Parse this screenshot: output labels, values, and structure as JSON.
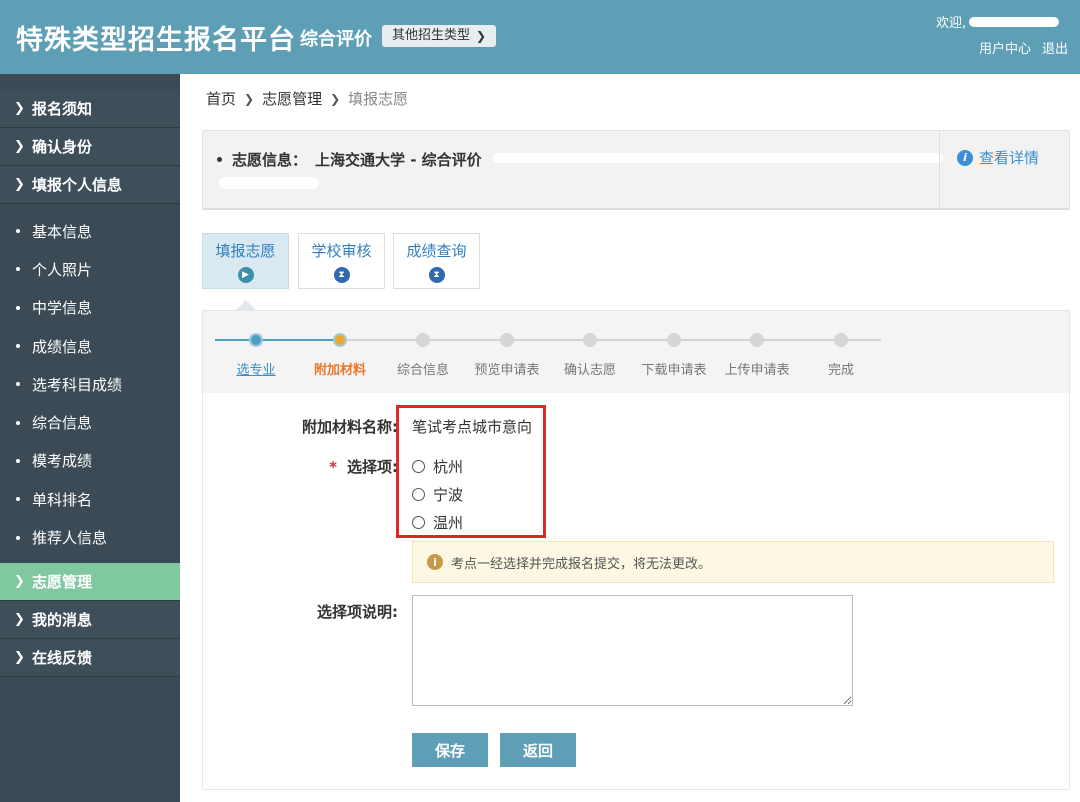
{
  "header": {
    "brand": "特殊类型招生报名平台",
    "subtitle": "综合评价",
    "other_type_label": "其他招生类型",
    "welcome": "欢迎,",
    "user_center": "用户中心",
    "logout": "退出"
  },
  "sidebar": {
    "items": [
      {
        "label": "报名须知"
      },
      {
        "label": "确认身份"
      },
      {
        "label": "填报个人信息"
      }
    ],
    "sub_items": [
      {
        "label": "基本信息"
      },
      {
        "label": "个人照片"
      },
      {
        "label": "中学信息"
      },
      {
        "label": "成绩信息"
      },
      {
        "label": "选考科目成绩"
      },
      {
        "label": "综合信息"
      },
      {
        "label": "模考成绩"
      },
      {
        "label": "单科排名"
      },
      {
        "label": "推荐人信息"
      }
    ],
    "bottom_items": [
      {
        "label": "志愿管理",
        "active": true
      },
      {
        "label": "我的消息"
      },
      {
        "label": "在线反馈"
      }
    ]
  },
  "breadcrumb": {
    "home": "首页",
    "section": "志愿管理",
    "current": "填报志愿"
  },
  "info": {
    "label": "志愿信息：",
    "value": "上海交通大学 - 综合评价",
    "detail_link": "查看详情"
  },
  "stage_tabs": [
    {
      "label": "填报志愿",
      "active": true
    },
    {
      "label": "学校审核"
    },
    {
      "label": "成绩查询"
    }
  ],
  "steps": [
    {
      "label": "选专业",
      "state": "done"
    },
    {
      "label": "附加材料",
      "state": "current"
    },
    {
      "label": "综合信息",
      "state": "todo"
    },
    {
      "label": "预览申请表",
      "state": "todo"
    },
    {
      "label": "确认志愿",
      "state": "todo"
    },
    {
      "label": "下载申请表",
      "state": "todo"
    },
    {
      "label": "上传申请表",
      "state": "todo"
    },
    {
      "label": "完成",
      "state": "todo"
    }
  ],
  "form": {
    "material_name_label": "附加材料名称:",
    "material_name_value": "笔试考点城市意向",
    "required_mark": "*",
    "option_label": "选择项:",
    "options": [
      "杭州",
      "宁波",
      "温州"
    ],
    "notice": "考点一经选择并完成报名提交，将无法更改。",
    "desc_label": "选择项说明:",
    "desc_value": "",
    "save_label": "保存",
    "back_label": "返回"
  },
  "colors": {
    "header_bg": "#5f9fb6",
    "sidebar_bg": "#3b4a54",
    "sidebar_active": "#7fc8a0",
    "step_done": "#4c9fc4",
    "step_current": "#f0a62a",
    "highlight_border": "#e22626"
  }
}
